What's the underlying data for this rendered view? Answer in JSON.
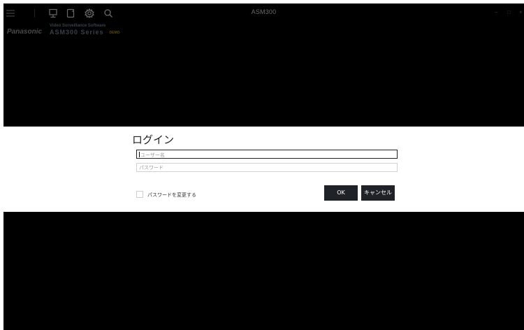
{
  "window": {
    "title": "ASM300",
    "controls": {
      "minimize": "–",
      "maximize": "□",
      "close": "×"
    }
  },
  "toolbar": {
    "icons": [
      "menu-icon",
      "monitor-icon",
      "device-icon",
      "gear-icon",
      "search-icon"
    ]
  },
  "branding": {
    "company": "Panasonic",
    "product_subtitle": "Video Surveillance Software",
    "product_name": "ASM300 Series",
    "edition_badge": "DEMO"
  },
  "login": {
    "title": "ログイン",
    "username": {
      "value": "",
      "placeholder": "ユーザー名"
    },
    "password": {
      "value": "",
      "placeholder": "パスワード"
    },
    "change_password_label": "パスワードを変更する",
    "change_password_checked": false,
    "ok_label": "OK",
    "cancel_label": "キャンセル"
  },
  "colors": {
    "background": "#000000",
    "dialog_band": "#ffffff",
    "button": "#1f2328",
    "button_text": "#ffffff"
  }
}
